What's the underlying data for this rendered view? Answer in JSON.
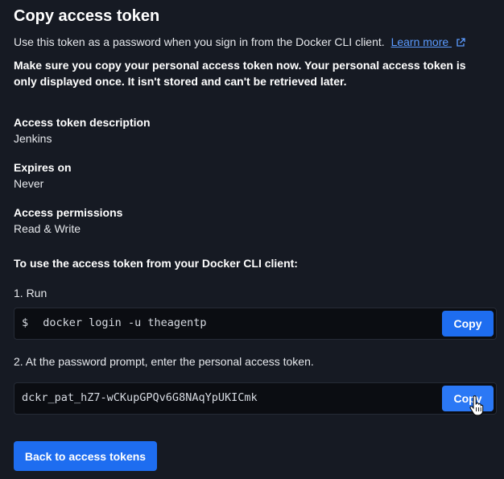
{
  "dialog": {
    "title": "Copy access token",
    "intro_text": "Use this token as a password when you sign in from the Docker CLI client.",
    "learn_more_label": "Learn more",
    "warning_text": "Make sure you copy your personal access token now. Your personal access token is only displayed once. It isn't stored and can't be retrieved later."
  },
  "fields": {
    "description_label": "Access token description",
    "description_value": "Jenkins",
    "expires_label": "Expires on",
    "expires_value": "Never",
    "permissions_label": "Access permissions",
    "permissions_value": "Read & Write"
  },
  "instructions": {
    "heading": "To use the access token from your Docker CLI client:",
    "step1": "1. Run",
    "step1_prompt": "$",
    "step1_command": "docker login -u theagentp",
    "step2": "2. At the password prompt, enter the personal access token.",
    "step2_token": "dckr_pat_hZ7-wCKupGPQv6G8NAqYpUKICmk",
    "copy_label": "Copy"
  },
  "footer": {
    "back_label": "Back to access tokens"
  },
  "colors": {
    "background": "#161a23",
    "accent": "#1e6df0",
    "link": "#5b9bff",
    "code_background": "#0b0d12"
  },
  "icons": {
    "learn_more": "external-link-icon",
    "cursor": "hand-pointer-cursor-icon"
  }
}
